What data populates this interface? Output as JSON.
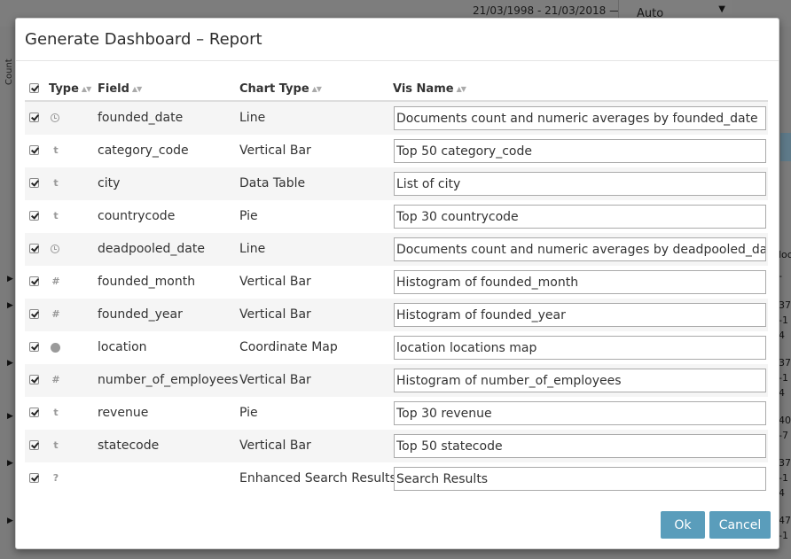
{
  "background": {
    "date_range": "21/03/1998 - 21/03/2018 —",
    "interval_select": "Auto",
    "y_axis_label": "Count",
    "right_col_fragments": [
      "loc",
      "-",
      "37",
      "-1",
      "4",
      "37",
      "-1",
      "4",
      "40",
      "-7",
      "37",
      "-1",
      "4",
      "47",
      "-1"
    ]
  },
  "modal": {
    "title": "Generate Dashboard – Report",
    "columns": {
      "type": "Type",
      "field": "Field",
      "chart_type": "Chart Type",
      "vis_name": "Vis Name"
    },
    "rows": [
      {
        "type_icon": "clock-icon",
        "field": "founded_date",
        "chart_type": "Line",
        "vis_name": "Documents count and numeric averages by founded_date"
      },
      {
        "type_icon": "t",
        "field": "category_code",
        "chart_type": "Vertical Bar",
        "vis_name": "Top 50 category_code"
      },
      {
        "type_icon": "t",
        "field": "city",
        "chart_type": "Data Table",
        "vis_name": "List of city"
      },
      {
        "type_icon": "t",
        "field": "countrycode",
        "chart_type": "Pie",
        "vis_name": "Top 30 countrycode"
      },
      {
        "type_icon": "clock-icon",
        "field": "deadpooled_date",
        "chart_type": "Line",
        "vis_name": "Documents count and numeric averages by deadpooled_date"
      },
      {
        "type_icon": "#",
        "field": "founded_month",
        "chart_type": "Vertical Bar",
        "vis_name": "Histogram of founded_month"
      },
      {
        "type_icon": "#",
        "field": "founded_year",
        "chart_type": "Vertical Bar",
        "vis_name": "Histogram of founded_year"
      },
      {
        "type_icon": "globe-icon",
        "field": "location",
        "chart_type": "Coordinate Map",
        "vis_name": "location locations map"
      },
      {
        "type_icon": "#",
        "field": "number_of_employees",
        "chart_type": "Vertical Bar",
        "vis_name": "Histogram of number_of_employees"
      },
      {
        "type_icon": "t",
        "field": "revenue",
        "chart_type": "Pie",
        "vis_name": "Top 30 revenue"
      },
      {
        "type_icon": "t",
        "field": "statecode",
        "chart_type": "Vertical Bar",
        "vis_name": "Top 50 statecode"
      },
      {
        "type_icon": "?",
        "field": "",
        "chart_type": "Enhanced Search Results",
        "vis_name": "Search Results"
      }
    ],
    "ok_label": "Ok",
    "cancel_label": "Cancel"
  }
}
